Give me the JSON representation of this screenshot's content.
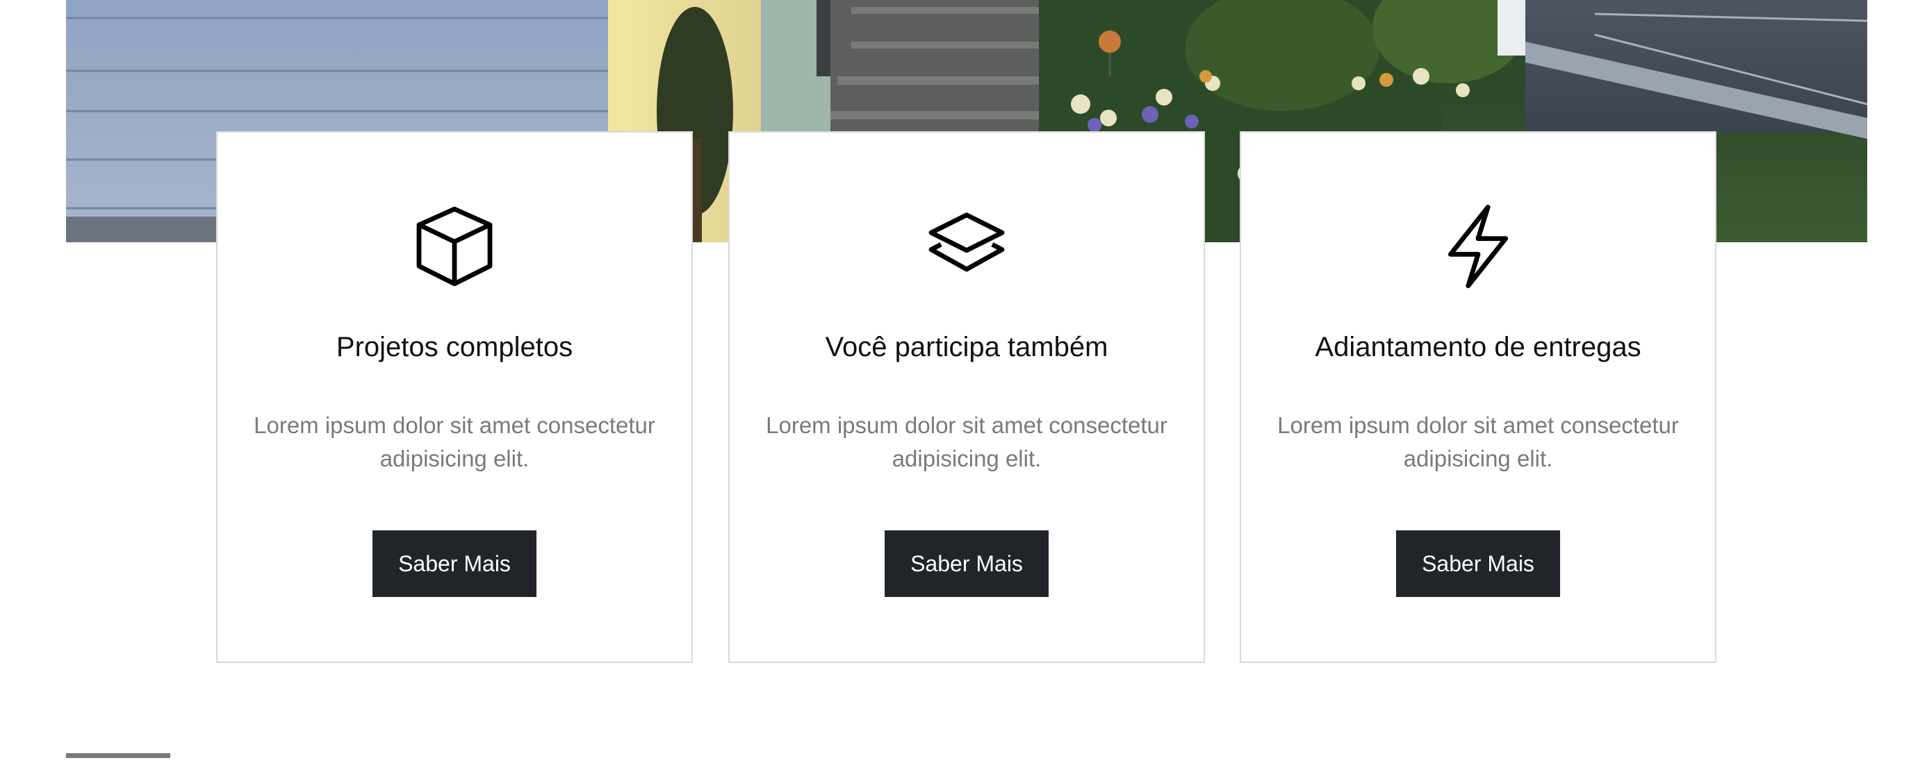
{
  "features": [
    {
      "icon": "box-icon",
      "title": "Projetos completos",
      "text": "Lorem ipsum dolor sit amet consectetur adipisicing elit.",
      "button_label": "Saber Mais"
    },
    {
      "icon": "layers-icon",
      "title": "Você participa também",
      "text": "Lorem ipsum dolor sit amet consectetur adipisicing elit.",
      "button_label": "Saber Mais"
    },
    {
      "icon": "lightning-icon",
      "title": "Adiantamento de entregas",
      "text": "Lorem ipsum dolor sit amet consectetur adipisicing elit.",
      "button_label": "Saber Mais"
    }
  ],
  "colors": {
    "button_bg": "#212529",
    "button_text": "#ffffff",
    "title_text": "#111111",
    "body_text": "#7a7a7a",
    "card_border": "#d9d9d9",
    "divider": "#7a7a7a"
  }
}
